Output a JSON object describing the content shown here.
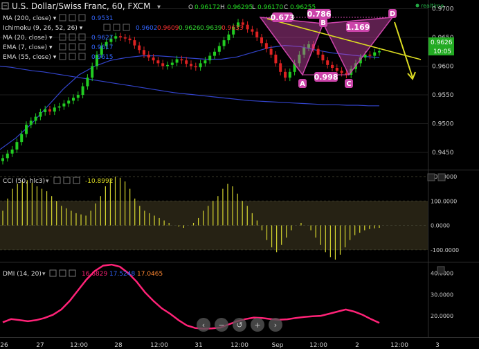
{
  "header": {
    "title": "U.S. Dollar/Swiss Franc, 60, FXCM",
    "ohlc": [
      {
        "k": "O",
        "v": "0.96172"
      },
      {
        "k": "H",
        "v": "0.96295"
      },
      {
        "k": "L",
        "v": "0.96170"
      },
      {
        "k": "C",
        "v": "0.96255"
      }
    ],
    "realtime": "realtime",
    "colors": {
      "up": "#22cc22",
      "down": "#dd2222",
      "ohlc_value": "#22dd22"
    }
  },
  "indicators": [
    {
      "label": "MA (200, close)",
      "values": [
        "0.9531"
      ],
      "colors": [
        "#3366ff"
      ]
    },
    {
      "label": "Ichimoku (9, 26, 52, 26)",
      "values": [
        "0.9602",
        "0.9609",
        "0.9626",
        "0.9639",
        "0.9633"
      ],
      "colors": [
        "#3366ff",
        "#ff3333",
        "#33dd33",
        "#33dd33",
        "#ff3333"
      ]
    },
    {
      "label": "MA (20, close)",
      "values": [
        "0.9627"
      ],
      "colors": [
        "#3366ff"
      ]
    },
    {
      "label": "EMA (7, close)",
      "values": [
        "0.9617"
      ],
      "colors": [
        "#3366ff"
      ]
    },
    {
      "label": "EMA (55, close)",
      "values": [
        "0.9615"
      ],
      "colors": [
        "#3366ff"
      ]
    }
  ],
  "pattern": {
    "points": [
      "A",
      "B",
      "C",
      "D"
    ],
    "ratios": [
      "0.673",
      "0.786",
      "0.998",
      "1.169"
    ],
    "color": "#cc44aa",
    "forecast_color": "#dddd22"
  },
  "price_axis": {
    "ticks": [
      "0.9700",
      "0.9650",
      "0.9600",
      "0.9550",
      "0.9500",
      "0.9450"
    ],
    "current_price": "0.9626",
    "countdown": "10:05"
  },
  "x_axis": {
    "ticks": [
      "26",
      "27",
      "12:00",
      "28",
      "12:00",
      "31",
      "12:00",
      "Sep",
      "12:00",
      "2",
      "12:00",
      "3"
    ]
  },
  "cci": {
    "label": "CCI (50, hlc3)",
    "value": "-10.8992",
    "ticks": [
      "200.0000",
      "100.0000",
      "0.0000",
      "-100.0000"
    ],
    "ylim": [
      -200,
      200
    ]
  },
  "dmi": {
    "label": "DMI (14, 20)",
    "values": [
      {
        "v": "16.6829",
        "color": "#ff2277"
      },
      {
        "v": "17.5248",
        "color": "#3366ff"
      },
      {
        "v": "17.0465",
        "color": "#ff8833"
      }
    ],
    "ticks": [
      "40.0000",
      "30.0000",
      "20.0000"
    ],
    "ylim": [
      10,
      45
    ]
  },
  "toolbar": {
    "buttons": [
      "zoom-out-button",
      "reset-button",
      "reload-button",
      "scroll-back-button",
      "scroll-forward-button"
    ]
  },
  "chart_data": [
    {
      "type": "line",
      "title": "U.S. Dollar/Swiss Franc, 60, FXCM",
      "ylim": [
        0.942,
        0.9715
      ],
      "series": [
        {
          "name": "Price",
          "values": [
            0.944,
            0.9448,
            0.9455,
            0.9468,
            0.9482,
            0.9498,
            0.9505,
            0.9512,
            0.952,
            0.9525,
            0.9521,
            0.9528,
            0.953,
            0.9535,
            0.954,
            0.9545,
            0.955,
            0.9565,
            0.958,
            0.96,
            0.962,
            0.9635,
            0.9642,
            0.9648,
            0.9652,
            0.965,
            0.9648,
            0.9645,
            0.9636,
            0.9628,
            0.962,
            0.9615,
            0.961,
            0.9605,
            0.96,
            0.9602,
            0.9606,
            0.9612,
            0.961,
            0.9604,
            0.96,
            0.9598,
            0.9605,
            0.961,
            0.9618,
            0.9625,
            0.9635,
            0.9645,
            0.9655,
            0.9668,
            0.9676,
            0.9672,
            0.9664,
            0.966,
            0.965,
            0.964,
            0.963,
            0.962,
            0.9605,
            0.959,
            0.958,
            0.959,
            0.9605,
            0.962,
            0.9632,
            0.9638,
            0.963,
            0.962,
            0.961,
            0.9602,
            0.9597,
            0.9592,
            0.9588,
            0.9585,
            0.9595,
            0.9605,
            0.9615,
            0.962,
            0.9618,
            0.9624,
            0.9626
          ]
        },
        {
          "name": "MA (200, close)",
          "values": [
            0.96,
            0.9598,
            0.9595,
            0.9592,
            0.959,
            0.9587,
            0.9584,
            0.9581,
            0.9578,
            0.9575,
            0.9572,
            0.9569,
            0.9566,
            0.9563,
            0.956,
            0.9557,
            0.9554,
            0.9552,
            0.955,
            0.9548,
            0.9546,
            0.9544,
            0.9542,
            0.954,
            0.9539,
            0.9538,
            0.9537,
            0.9536,
            0.9535,
            0.9534,
            0.9533,
            0.9533,
            0.9532,
            0.9532,
            0.9531,
            0.9531
          ]
        },
        {
          "name": "EMA (55, close)",
          "values": [
            0.9455,
            0.9475,
            0.95,
            0.953,
            0.956,
            0.9585,
            0.96,
            0.961,
            0.9615,
            0.9618,
            0.9618,
            0.9616,
            0.9614,
            0.9612,
            0.9612,
            0.9616,
            0.9624,
            0.9632,
            0.9636,
            0.9634,
            0.9628,
            0.9623,
            0.962,
            0.9617,
            0.9615
          ]
        }
      ]
    },
    {
      "type": "bar",
      "title": "CCI (50, hlc3)",
      "ylim": [
        -200,
        200
      ],
      "values": [
        60,
        110,
        150,
        170,
        180,
        185,
        175,
        160,
        150,
        140,
        120,
        100,
        80,
        70,
        60,
        50,
        45,
        40,
        60,
        90,
        120,
        160,
        190,
        200,
        195,
        180,
        150,
        110,
        80,
        60,
        50,
        40,
        30,
        20,
        10,
        0,
        -5,
        -10,
        0,
        10,
        30,
        60,
        80,
        100,
        120,
        150,
        170,
        160,
        130,
        100,
        80,
        50,
        20,
        -20,
        -60,
        -90,
        -110,
        -80,
        -50,
        -20,
        0,
        10,
        0,
        -20,
        -50,
        -80,
        -110,
        -130,
        -140,
        -120,
        -90,
        -60,
        -40,
        -30,
        -20,
        -15,
        -12,
        -10
      ]
    },
    {
      "type": "line",
      "title": "DMI (14, 20)",
      "ylim": [
        10,
        45
      ],
      "series": [
        {
          "name": "ADX",
          "values": [
            17,
            18.5,
            18,
            17.5,
            18,
            19,
            20.5,
            23,
            27,
            32,
            37,
            41,
            43.5,
            44,
            43,
            40,
            36,
            31,
            27,
            23.5,
            21,
            18,
            15.5,
            14.3,
            14,
            14.1,
            14.5,
            16,
            17.5,
            18.5,
            19.2,
            19,
            18.5,
            18.2,
            18.4,
            19,
            19.5,
            19.8,
            20,
            21,
            22,
            23,
            22,
            20.5,
            18.5,
            16.7
          ]
        }
      ]
    }
  ]
}
